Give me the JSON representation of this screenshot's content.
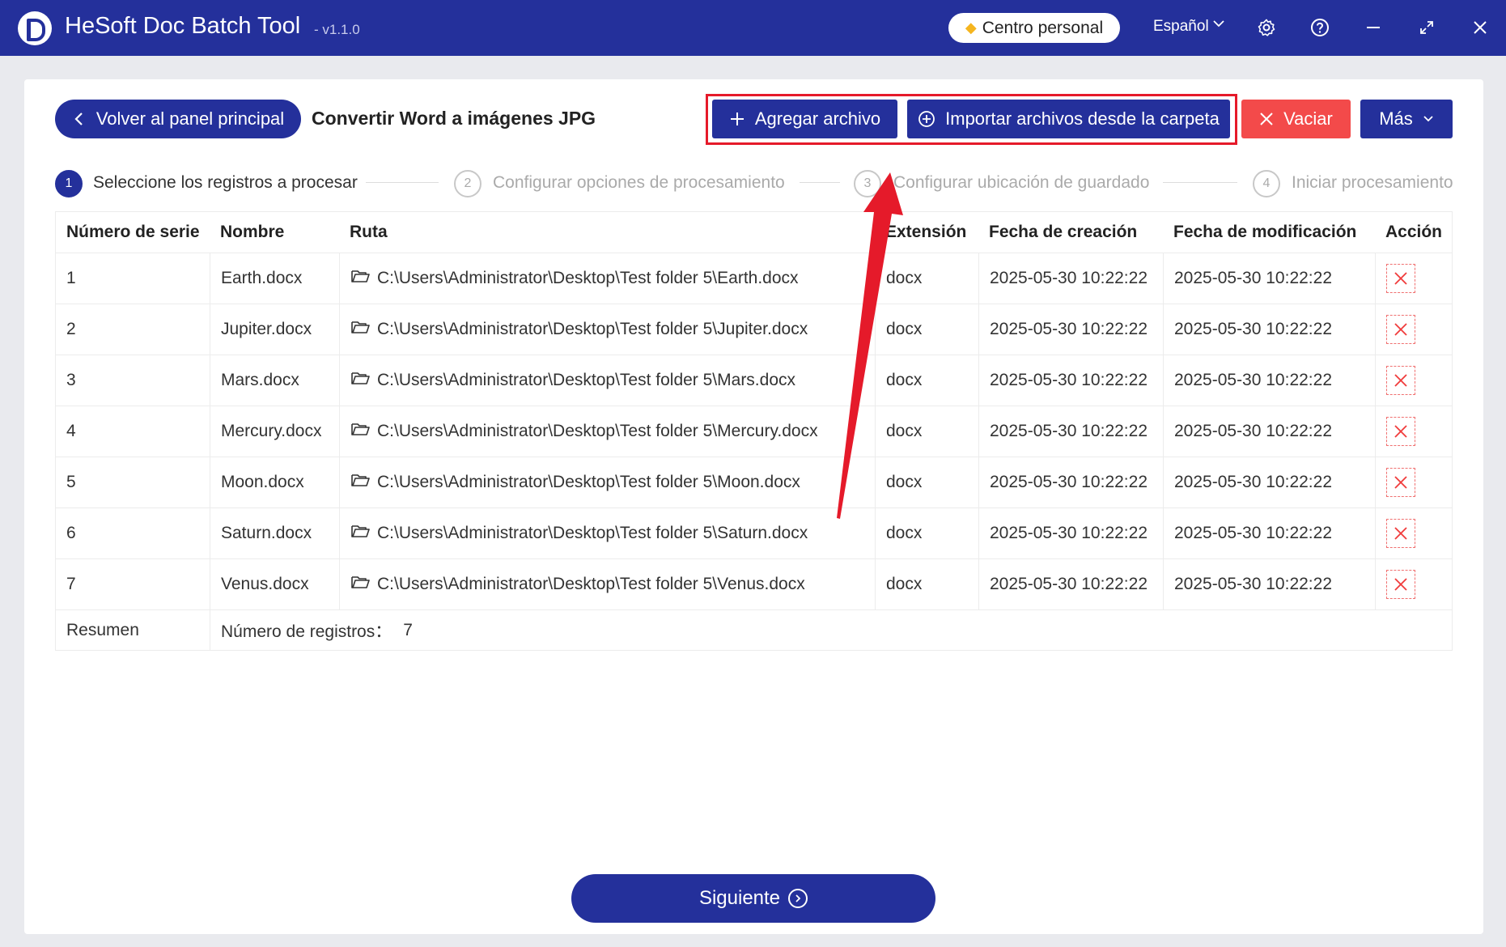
{
  "app": {
    "title": "HeSoft Doc Batch Tool",
    "version": "- v1.1.0"
  },
  "titlebar": {
    "personal_center": "Centro personal",
    "language": "Español",
    "icons": [
      "settings-icon",
      "help-icon",
      "minimize-icon",
      "maximize-icon",
      "close-icon"
    ]
  },
  "toolbar": {
    "back_label": "Volver al panel principal",
    "page_title": "Convertir Word a imágenes JPG",
    "add_file_label": "Agregar archivo",
    "import_folder_label": "Importar archivos desde la carpeta",
    "clear_label": "Vaciar",
    "more_label": "Más"
  },
  "steps": [
    {
      "num": "1",
      "label": "Seleccione los registros a procesar",
      "active": true
    },
    {
      "num": "2",
      "label": "Configurar opciones de procesamiento",
      "active": false
    },
    {
      "num": "3",
      "label": "Configurar ubicación de guardado",
      "active": false
    },
    {
      "num": "4",
      "label": "Iniciar procesamiento",
      "active": false
    }
  ],
  "table": {
    "headers": [
      "Número de serie",
      "Nombre",
      "Ruta",
      "Extensión",
      "Fecha de creación",
      "Fecha de modificación",
      "Acción"
    ],
    "rows": [
      {
        "no": "1",
        "name": "Earth.docx",
        "path": "C:\\Users\\Administrator\\Desktop\\Test folder 5\\Earth.docx",
        "ext": "docx",
        "created": "2025-05-30 10:22:22",
        "modified": "2025-05-30 10:22:22"
      },
      {
        "no": "2",
        "name": "Jupiter.docx",
        "path": "C:\\Users\\Administrator\\Desktop\\Test folder 5\\Jupiter.docx",
        "ext": "docx",
        "created": "2025-05-30 10:22:22",
        "modified": "2025-05-30 10:22:22"
      },
      {
        "no": "3",
        "name": "Mars.docx",
        "path": "C:\\Users\\Administrator\\Desktop\\Test folder 5\\Mars.docx",
        "ext": "docx",
        "created": "2025-05-30 10:22:22",
        "modified": "2025-05-30 10:22:22"
      },
      {
        "no": "4",
        "name": "Mercury.docx",
        "path": "C:\\Users\\Administrator\\Desktop\\Test folder 5\\Mercury.docx",
        "ext": "docx",
        "created": "2025-05-30 10:22:22",
        "modified": "2025-05-30 10:22:22"
      },
      {
        "no": "5",
        "name": "Moon.docx",
        "path": "C:\\Users\\Administrator\\Desktop\\Test folder 5\\Moon.docx",
        "ext": "docx",
        "created": "2025-05-30 10:22:22",
        "modified": "2025-05-30 10:22:22"
      },
      {
        "no": "6",
        "name": "Saturn.docx",
        "path": "C:\\Users\\Administrator\\Desktop\\Test folder 5\\Saturn.docx",
        "ext": "docx",
        "created": "2025-05-30 10:22:22",
        "modified": "2025-05-30 10:22:22"
      },
      {
        "no": "7",
        "name": "Venus.docx",
        "path": "C:\\Users\\Administrator\\Desktop\\Test folder 5\\Venus.docx",
        "ext": "docx",
        "created": "2025-05-30 10:22:22",
        "modified": "2025-05-30 10:22:22"
      }
    ],
    "summary_label": "Resumen",
    "summary_count_label": "Número de registros：",
    "summary_count": "7"
  },
  "footer": {
    "next_label": "Siguiente"
  },
  "colors": {
    "primary": "#24309b",
    "danger": "#f34a4a",
    "annotation": "#e51a2a"
  }
}
